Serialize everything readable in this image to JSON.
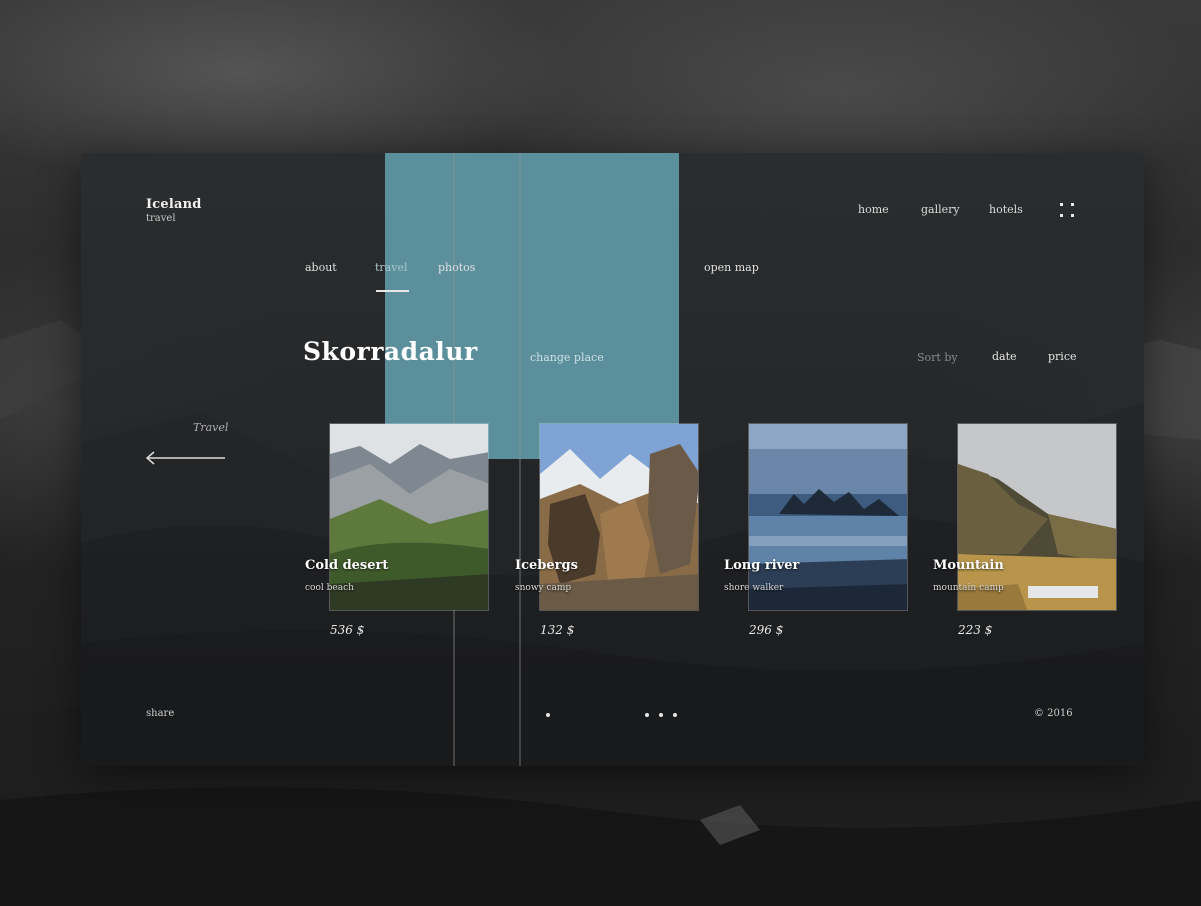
{
  "brand": {
    "title": "Iceland",
    "subtitle": "travel"
  },
  "topnav": {
    "items": [
      {
        "label": "home"
      },
      {
        "label": "gallery"
      },
      {
        "label": "hotels"
      }
    ],
    "menu_icon": "grid-menu-icon"
  },
  "subnav": {
    "items": [
      {
        "label": "about"
      },
      {
        "label": "travel",
        "active": true
      },
      {
        "label": "photos"
      }
    ],
    "open_map": "open map"
  },
  "main": {
    "place": "Skorradalur",
    "change_place": "change place",
    "sort_label": "Sort by",
    "sort_options": [
      {
        "label": "date"
      },
      {
        "label": "price"
      }
    ],
    "back_label": "Travel",
    "back_icon": "arrow-left-icon"
  },
  "cards": [
    {
      "name": "Cold desert",
      "sub": "cool beach",
      "price": "536 $"
    },
    {
      "name": "Icebergs",
      "sub": "snowy camp",
      "price": "132 $"
    },
    {
      "name": "Long river",
      "sub": "shore walker",
      "price": "296 $"
    },
    {
      "name": "Mountain",
      "sub": "mountain camp",
      "price": "223 $"
    }
  ],
  "footer": {
    "share": "share",
    "copyright": "© 2016"
  },
  "colors": {
    "accent": "#5a8f9b",
    "card_bg": "#2a2c2e",
    "text": "#ffffff"
  }
}
